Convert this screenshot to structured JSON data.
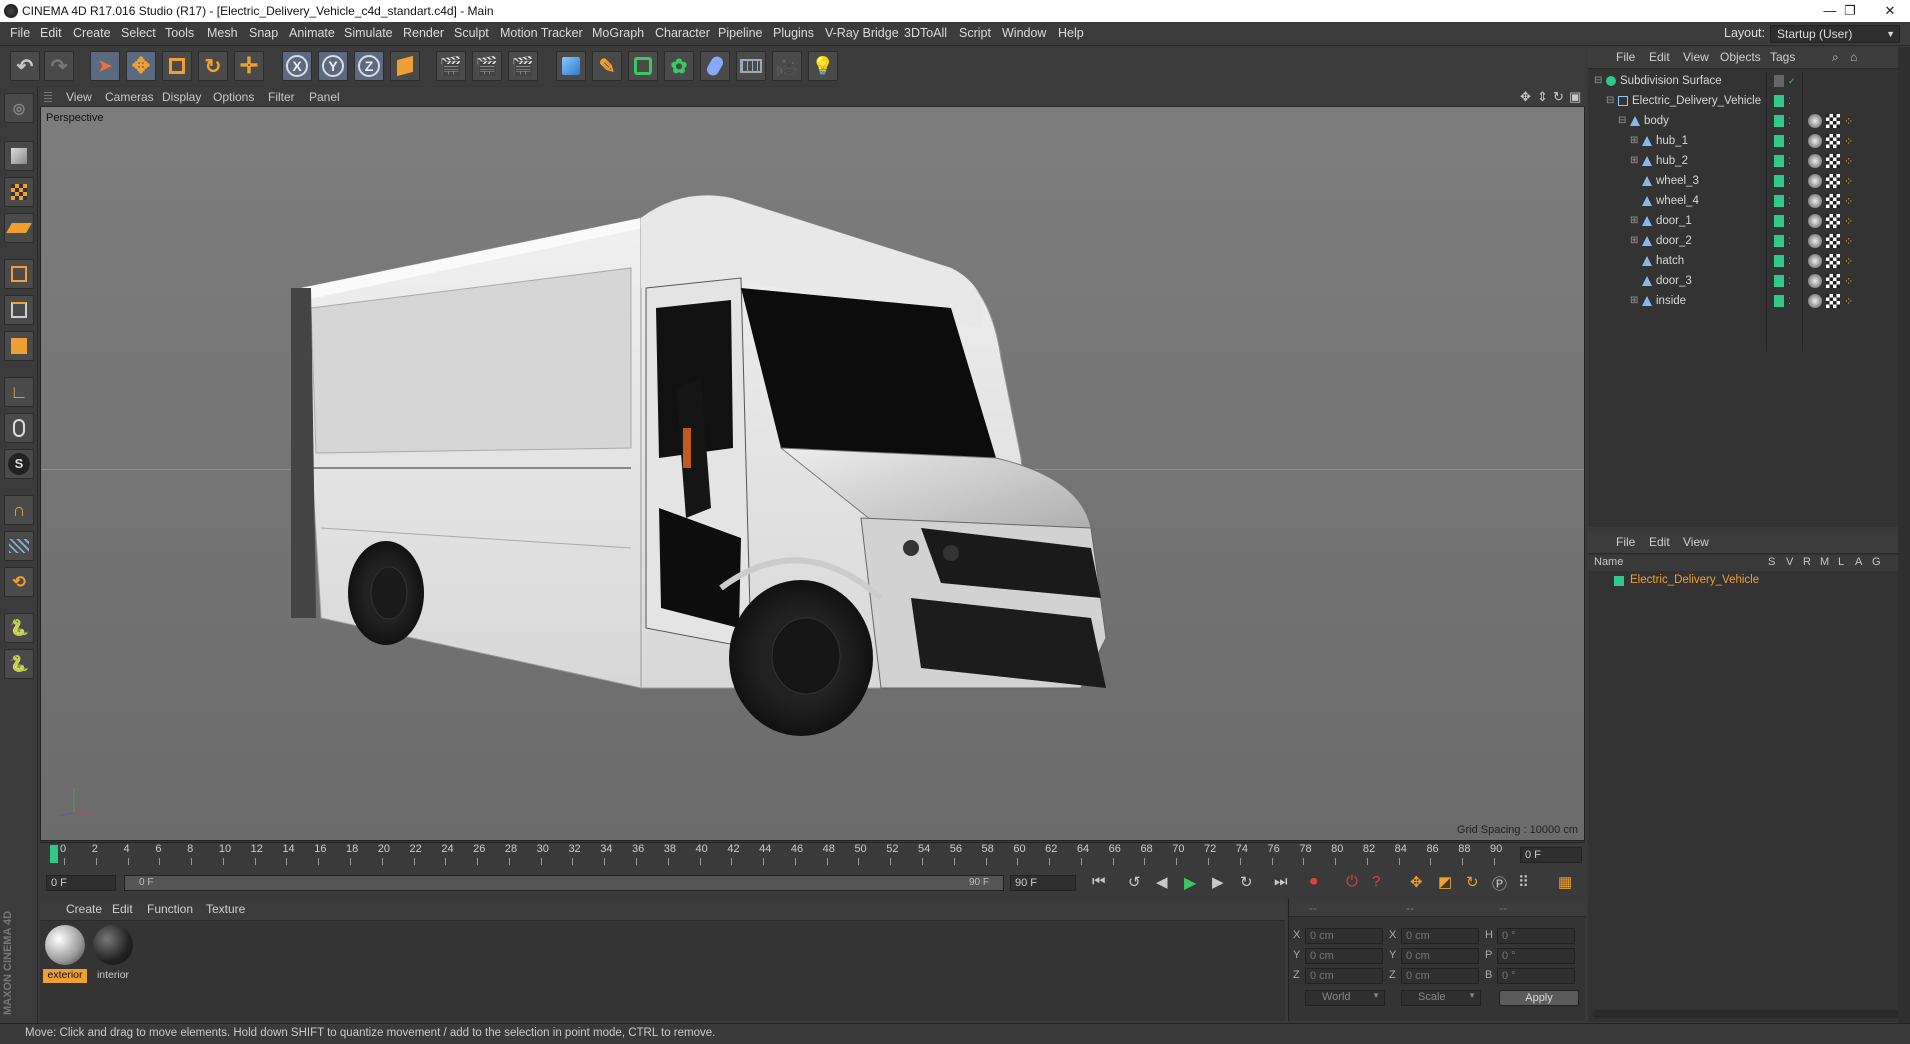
{
  "window": {
    "title": "CINEMA 4D R17.016 Studio (R17) - [Electric_Delivery_Vehicle_c4d_standart.c4d] - Main",
    "controls": [
      "—",
      "❐",
      "✕"
    ]
  },
  "menubar": {
    "items": [
      "File",
      "Edit",
      "Create",
      "Select",
      "Tools",
      "Mesh",
      "Snap",
      "Animate",
      "Simulate",
      "Render",
      "Sculpt",
      "Motion Tracker",
      "MoGraph",
      "Character",
      "Pipeline",
      "Plugins",
      "V-Ray Bridge",
      "3DToAll",
      "Script",
      "Window",
      "Help"
    ],
    "layout_label": "Layout:",
    "layout_value": "Startup (User)"
  },
  "toolbar": {
    "axis_x": "X",
    "axis_y": "Y",
    "axis_z": "Z"
  },
  "viewport": {
    "menu": [
      "View",
      "Cameras",
      "Display",
      "Options",
      "Filter",
      "Panel"
    ],
    "camera_label": "Perspective",
    "grid_spacing": "Grid Spacing : 10000 cm"
  },
  "object_manager": {
    "menu": [
      "File",
      "Edit",
      "View",
      "Objects",
      "Tags"
    ],
    "objects": [
      {
        "name": "Subdivision Surface",
        "indent": 0,
        "expander": "⊟"
      },
      {
        "name": "Electric_Delivery_Vehicle",
        "indent": 1,
        "expander": "⊟"
      },
      {
        "name": "body",
        "indent": 2,
        "expander": "⊟"
      },
      {
        "name": "hub_1",
        "indent": 3,
        "expander": "⊞"
      },
      {
        "name": "hub_2",
        "indent": 3,
        "expander": "⊞"
      },
      {
        "name": "wheel_3",
        "indent": 3,
        "expander": ""
      },
      {
        "name": "wheel_4",
        "indent": 3,
        "expander": ""
      },
      {
        "name": "door_1",
        "indent": 3,
        "expander": "⊞"
      },
      {
        "name": "door_2",
        "indent": 3,
        "expander": "⊞"
      },
      {
        "name": "hatch",
        "indent": 3,
        "expander": ""
      },
      {
        "name": "door_3",
        "indent": 3,
        "expander": ""
      },
      {
        "name": "inside",
        "indent": 3,
        "expander": "⊞"
      }
    ]
  },
  "layer_manager": {
    "menu": [
      "File",
      "Edit",
      "View"
    ],
    "columns": [
      "Name",
      "S",
      "V",
      "R",
      "M",
      "L",
      "A",
      "G"
    ],
    "rows": [
      {
        "name": "Electric_Delivery_Vehicle"
      }
    ]
  },
  "timeline": {
    "frames": [
      "0",
      "2",
      "4",
      "6",
      "8",
      "10",
      "12",
      "14",
      "16",
      "18",
      "20",
      "22",
      "24",
      "26",
      "28",
      "30",
      "32",
      "34",
      "36",
      "38",
      "40",
      "42",
      "44",
      "46",
      "48",
      "50",
      "52",
      "54",
      "56",
      "58",
      "60",
      "62",
      "64",
      "66",
      "68",
      "70",
      "72",
      "74",
      "76",
      "78",
      "80",
      "82",
      "84",
      "86",
      "88",
      "90"
    ],
    "current_frame": "0 F",
    "start_field": "0 F",
    "range_start": "0 F",
    "range_end": "90 F",
    "end_field": "90 F"
  },
  "material_manager": {
    "menu": [
      "Create",
      "Edit",
      "Function",
      "Texture"
    ],
    "materials": [
      {
        "name": "exterior",
        "selected": true
      },
      {
        "name": "interior",
        "selected": false
      }
    ],
    "side_logo": "MAXON CINEMA 4D"
  },
  "coordinates": {
    "headers": [
      "--",
      "--",
      "--"
    ],
    "rows": [
      {
        "a": "X",
        "av": "0 cm",
        "b": "X",
        "bv": "0 cm",
        "c": "H",
        "cv": "0 °"
      },
      {
        "a": "Y",
        "av": "0 cm",
        "b": "Y",
        "bv": "0 cm",
        "c": "P",
        "cv": "0 °"
      },
      {
        "a": "Z",
        "av": "0 cm",
        "b": "Z",
        "bv": "0 cm",
        "c": "B",
        "cv": "0 °"
      }
    ],
    "mode_world": "World",
    "mode_scale": "Scale",
    "apply": "Apply"
  },
  "statusbar": {
    "text": "Move: Click and drag to move elements. Hold down SHIFT to quantize movement / add to the selection in point mode, CTRL to remove."
  },
  "colors": {
    "accent_orange": "#f0a030",
    "layer_green": "#2fc98a",
    "selection_blue": "#5b6a80"
  }
}
